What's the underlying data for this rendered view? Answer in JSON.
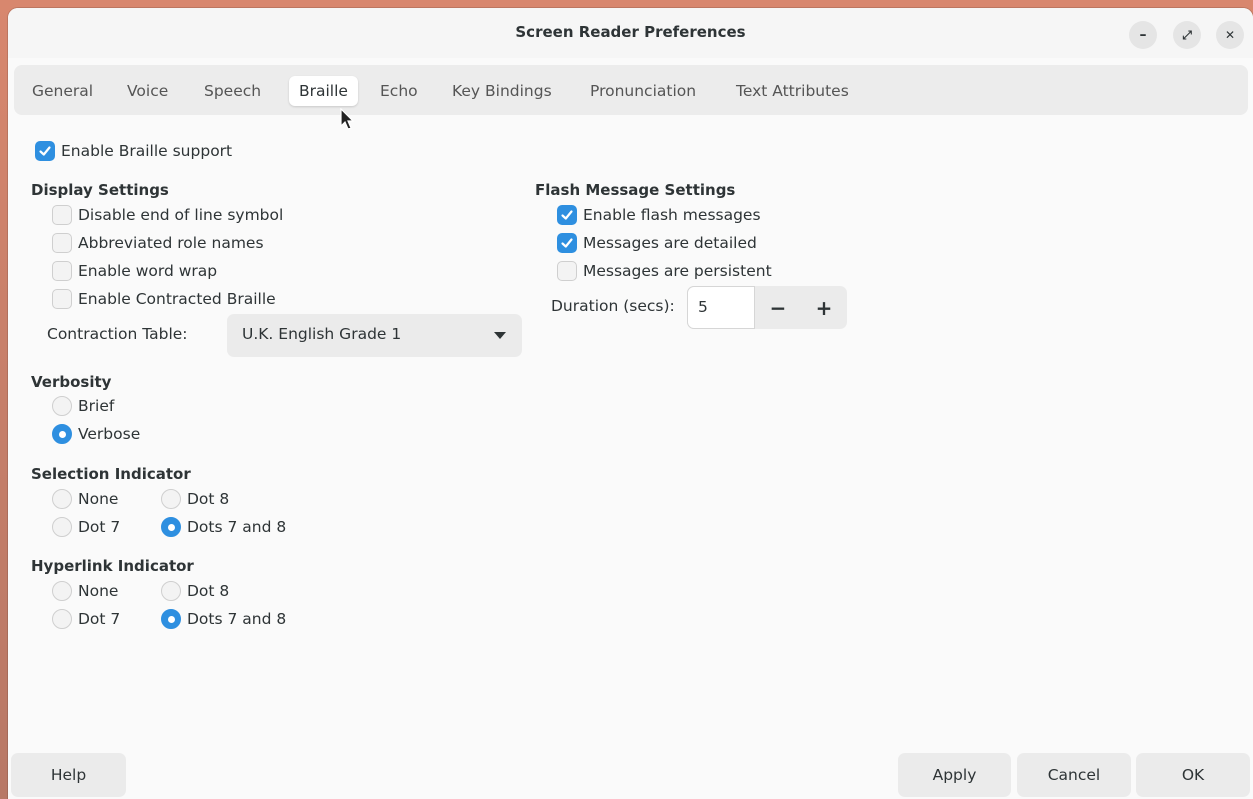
{
  "window": {
    "title": "Screen Reader Preferences",
    "controls": {
      "minimize": "–",
      "maximize": "⤢",
      "close": "✕"
    }
  },
  "tabs": [
    "General",
    "Voice",
    "Speech",
    "Braille",
    "Echo",
    "Key Bindings",
    "Pronunciation",
    "Text Attributes"
  ],
  "active_tab": "Braille",
  "braille": {
    "enable_label": "Enable Braille support",
    "enable_checked": true,
    "display_settings": {
      "heading": "Display Settings",
      "options": [
        {
          "label": "Disable end of line symbol",
          "checked": false
        },
        {
          "label": "Abbreviated role names",
          "checked": false
        },
        {
          "label": "Enable word wrap",
          "checked": false
        },
        {
          "label": "Enable Contracted Braille",
          "checked": false
        }
      ],
      "contraction_label": "Contraction Table:",
      "contraction_value": "U.K. English Grade 1"
    },
    "verbosity": {
      "heading": "Verbosity",
      "options": [
        {
          "label": "Brief",
          "selected": false
        },
        {
          "label": "Verbose",
          "selected": true
        }
      ]
    },
    "selection_indicator": {
      "heading": "Selection Indicator",
      "options": [
        {
          "label": "None",
          "selected": false
        },
        {
          "label": "Dot 8",
          "selected": false
        },
        {
          "label": "Dot 7",
          "selected": false
        },
        {
          "label": "Dots 7 and 8",
          "selected": true
        }
      ]
    },
    "hyperlink_indicator": {
      "heading": "Hyperlink Indicator",
      "options": [
        {
          "label": "None",
          "selected": false
        },
        {
          "label": "Dot 8",
          "selected": false
        },
        {
          "label": "Dot 7",
          "selected": false
        },
        {
          "label": "Dots 7 and 8",
          "selected": true
        }
      ]
    },
    "flash": {
      "heading": "Flash Message Settings",
      "options": [
        {
          "label": "Enable flash messages",
          "checked": true
        },
        {
          "label": "Messages are detailed",
          "checked": true
        },
        {
          "label": "Messages are persistent",
          "checked": false
        }
      ],
      "duration_label": "Duration (secs):",
      "duration_value": "5",
      "minus": "−",
      "plus": "+"
    }
  },
  "footer": {
    "help": "Help",
    "apply": "Apply",
    "cancel": "Cancel",
    "ok": "OK"
  },
  "colors": {
    "accent": "#2e8fe0",
    "window_bg": "#fafafa",
    "button_bg": "#ebebeb"
  }
}
